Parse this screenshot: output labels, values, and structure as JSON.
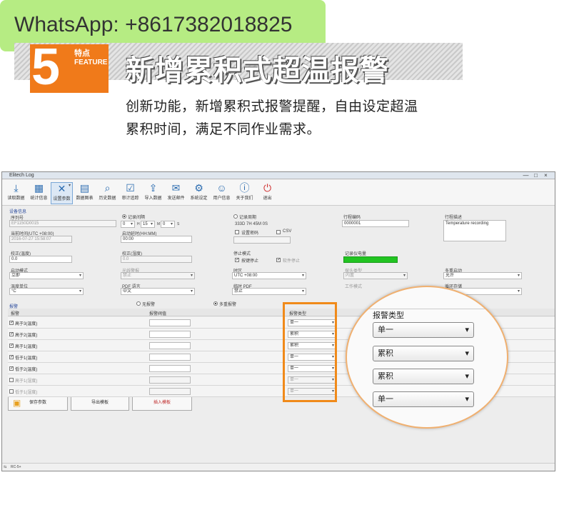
{
  "promo": {
    "whatsapp": "WhatsApp: +8617382018825",
    "feature_number": "5",
    "feature_cn": "特点",
    "feature_en": "FEATURE",
    "headline": "新增累积式超温报警",
    "desc_line1": "创新功能，新增累积式报警提醒，自由设定超温",
    "desc_line2": "累积时间，满足不同作业需求。"
  },
  "window": {
    "title": "Elitech Log",
    "controls": {
      "min": "—",
      "max": "□",
      "close": "×"
    },
    "toolbar": [
      {
        "label": "读取数据",
        "icon": "⤓",
        "icon_name": "download-icon"
      },
      {
        "label": "统计信息",
        "icon": "▦",
        "icon_name": "stats-icon"
      },
      {
        "label": "设置参数",
        "icon": "✕",
        "icon_name": "tools-icon"
      },
      {
        "label": "数据图表",
        "icon": "▤",
        "icon_name": "chart-icon"
      },
      {
        "label": "历史数据",
        "icon": "⌕",
        "icon_name": "history-icon"
      },
      {
        "label": "审计追踪",
        "icon": "☑",
        "icon_name": "audit-icon"
      },
      {
        "label": "导入数据",
        "icon": "⇪",
        "icon_name": "import-icon"
      },
      {
        "label": "发送邮件",
        "icon": "✉",
        "icon_name": "mail-icon"
      },
      {
        "label": "系统设定",
        "icon": "⚙",
        "icon_name": "gear-icon"
      },
      {
        "label": "用户信息",
        "icon": "☺",
        "icon_name": "user-icon"
      },
      {
        "label": "关于我们",
        "icon": "ⓘ",
        "icon_name": "info-icon"
      },
      {
        "label": "退出",
        "icon": "⏻",
        "icon_name": "power-icon"
      }
    ],
    "device_info": "设备信息",
    "serial_label": "序列号",
    "serial_value": "EF1150D0015",
    "time_label": "当前时间(UTC +08:00)",
    "time_value": "2016-07-27 15:58:07",
    "record_interval_label": "记录间隔",
    "interval": {
      "h": "0",
      "h_unit": "H",
      "m": "15",
      "m_unit": "M",
      "s": "0",
      "s_unit": "S"
    },
    "start_delay_label": "启动延时(HH:MM)",
    "start_delay_value": "00:00",
    "record_cycle_label": "记录周期",
    "record_cycle_value": "333D 7H 45M 0S",
    "set_password_label": "设置密码",
    "csv_label": "CSV",
    "trip_no_label": "行程编码",
    "trip_no_value": "0000001",
    "trip_desc_label": "行程描述",
    "trip_desc_value": "Temperature recording",
    "calib_temp_label": "校正(温度)",
    "calib_temp_value": "0.0",
    "calib_hum_label": "校正(湿度)",
    "calib_hum_value": "0.0",
    "stop_mode_label": "停止模式",
    "key_stop_label": "按键停止",
    "soft_stop_label": "软件停止",
    "battery_label": "记录仪电量",
    "start_mode_label": "启动模式",
    "start_mode_value": "立即",
    "light_label": "光线警报",
    "light_value": "禁止",
    "timezone_label": "时区",
    "timezone_value": "UTC +08:00",
    "probe_label": "探头类型",
    "probe_value": "内置",
    "multi_start_label": "多重启动",
    "multi_start_value": "允许",
    "temp_unit_label": "温度单位",
    "temp_unit_value": "°C",
    "pdf_lang_label": "PDF 语言",
    "pdf_lang_value": "中文",
    "temp_pdf_label": "临时 PDF",
    "temp_pdf_value": "禁止",
    "work_mode_label": "工作模式",
    "loop_label": "循环存储",
    "loop_value": "禁止",
    "no_alarm_label": "无报警",
    "multi_alarm_label": "多重报警",
    "alarm_section": "报警",
    "alarm_header": "报警",
    "threshold_header": "报警阀值",
    "type_header": "报警类型",
    "alarm_rows": [
      {
        "label": "高于3(温度)",
        "checked": true,
        "type": "单一"
      },
      {
        "label": "高于2(温度)",
        "checked": true,
        "type": "累积"
      },
      {
        "label": "高于1(温度)",
        "checked": true,
        "type": "累积"
      },
      {
        "label": "低于1(温度)",
        "checked": true,
        "type": "单一"
      },
      {
        "label": "低于2(温度)",
        "checked": true,
        "type": "单一"
      },
      {
        "label": "高于1(湿度)",
        "checked": false,
        "type": "单一"
      },
      {
        "label": "低于1(湿度)",
        "checked": false,
        "type": "单一"
      }
    ],
    "save_button": "保存参数",
    "export_button": "导出模板",
    "import_button": "插入模板",
    "status": "RC-5+",
    "check_mark": "✓"
  },
  "zoom": {
    "title": "报警类型",
    "options": [
      "单一",
      "累积",
      "累积",
      "单一"
    ]
  },
  "colors": {
    "highlight": "#f08a1a",
    "battery": "#22c422",
    "accent": "#2f4f9f"
  }
}
